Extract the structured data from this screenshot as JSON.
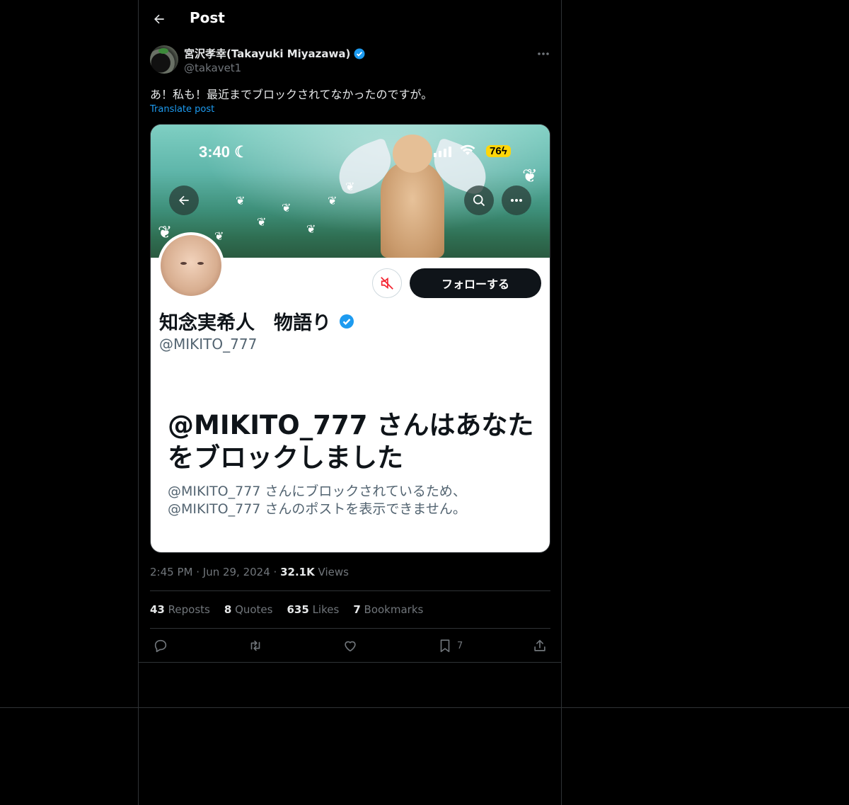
{
  "header": {
    "title": "Post"
  },
  "author": {
    "display_name": "宮沢孝幸(Takayuki Miyazawa)",
    "handle": "@takavet1",
    "verified": true
  },
  "post": {
    "text": "あ！私も！最近までブロックされてなかったのですが。",
    "translate_label": "Translate post",
    "time": "2:45 PM",
    "date": "Jun 29, 2024",
    "views_count": "32.1K",
    "views_label": "Views"
  },
  "screenshot": {
    "status_time": "3:40",
    "battery": "76",
    "follow_label": "フォローする",
    "profile_name": "知念実希人　物語り",
    "profile_handle": "@MIKITO_777",
    "blocked_title": "@MIKITO_777 さんはあなたをブロックしました",
    "blocked_desc_line1": "@MIKITO_777 さんにブロックされているため、",
    "blocked_desc_line2": "@MIKITO_777 さんのポストを表示できません。"
  },
  "stats": {
    "reposts_count": "43",
    "reposts_label": "Reposts",
    "quotes_count": "8",
    "quotes_label": "Quotes",
    "likes_count": "635",
    "likes_label": "Likes",
    "bookmarks_count": "7",
    "bookmarks_label": "Bookmarks"
  },
  "actions": {
    "bookmark_count": "7"
  },
  "icons": [
    "back-arrow-icon",
    "verified-badge-icon",
    "more-icon",
    "reply-icon",
    "repost-icon",
    "like-icon",
    "bookmark-icon",
    "share-icon"
  ],
  "colors": {
    "background": "#000000",
    "text": "#e7e9ea",
    "muted": "#71767b",
    "accent": "#1d9bf0",
    "border": "#2f3336"
  }
}
